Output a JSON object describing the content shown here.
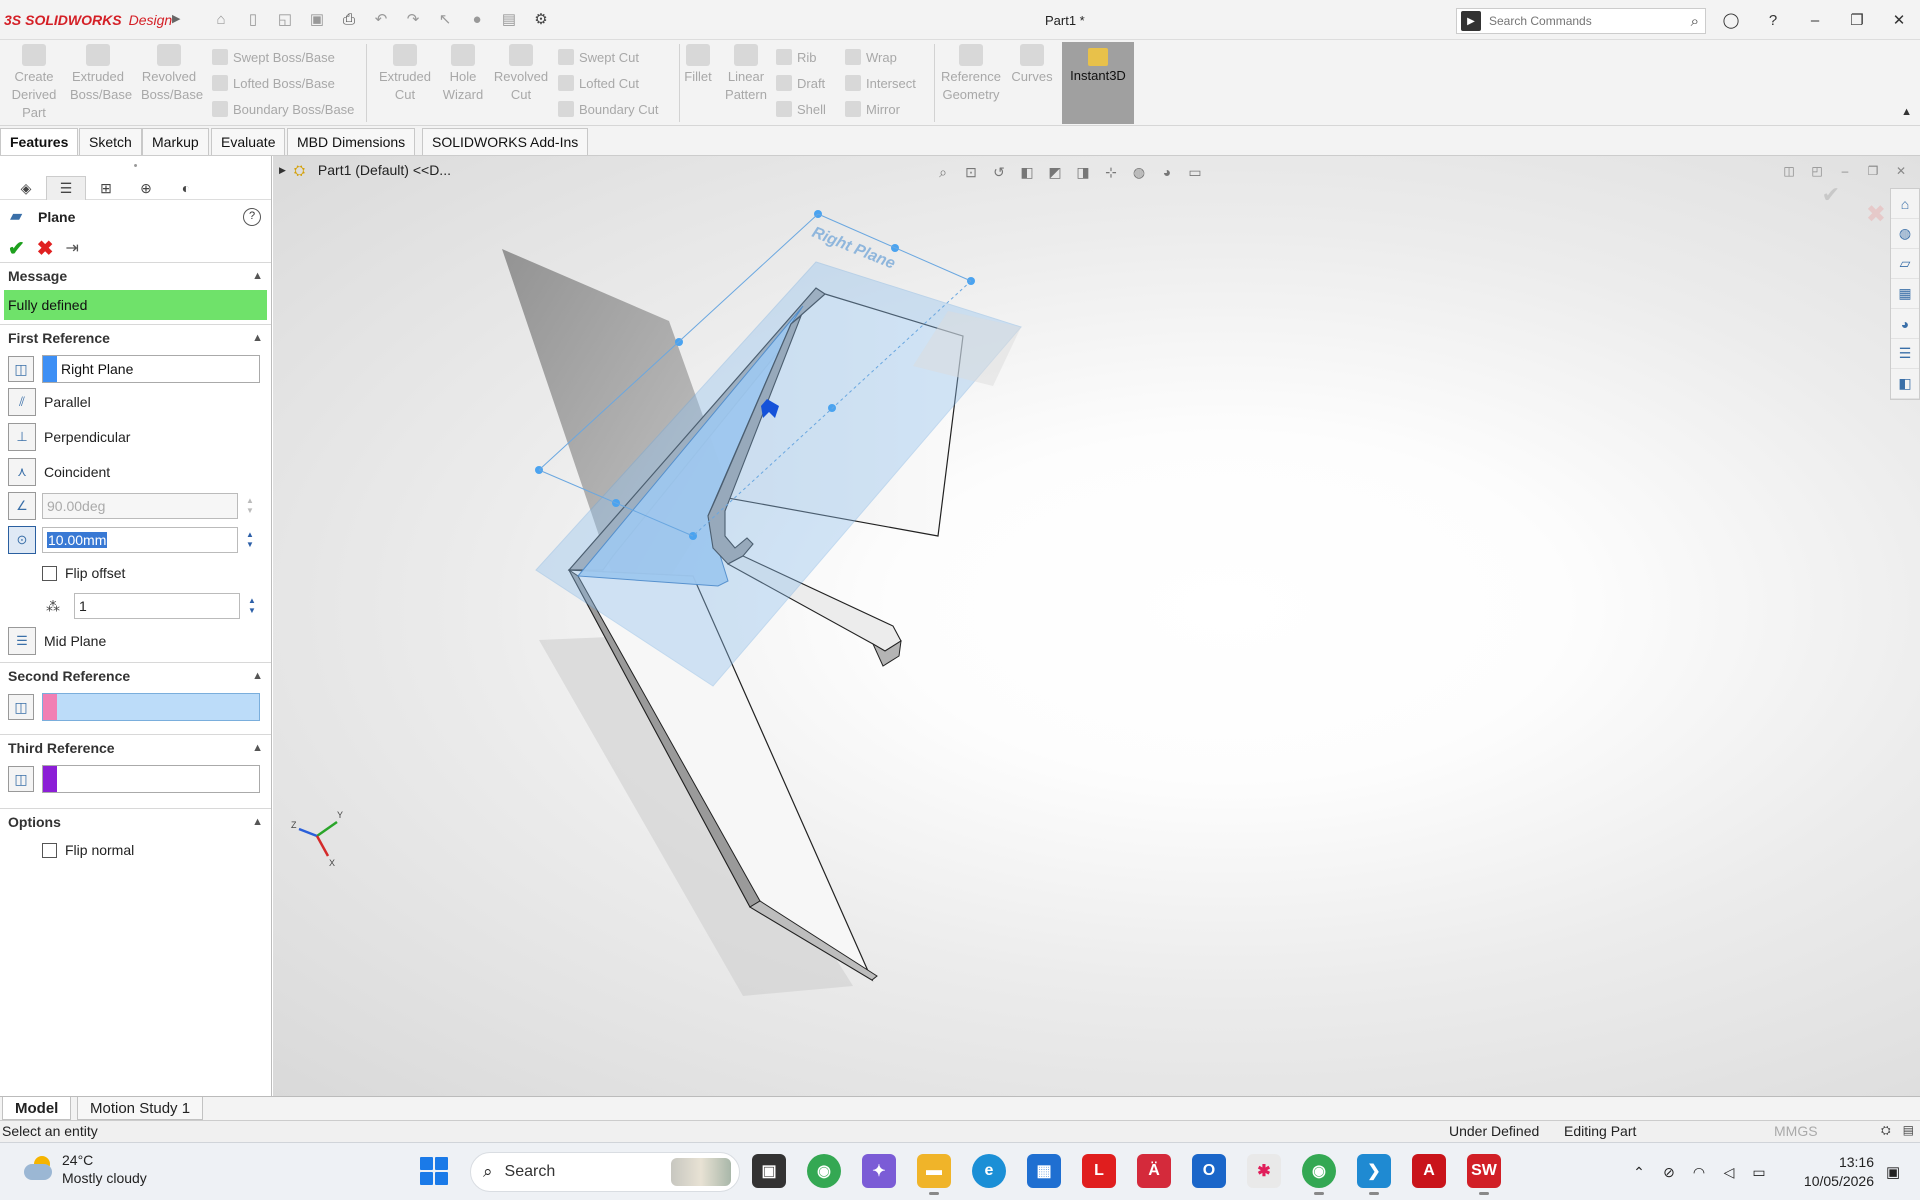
{
  "app": {
    "brand_ds": "3S",
    "brand_name": "SOLIDWORKS",
    "brand_suffix": "Design",
    "doc_title": "Part1 *",
    "search_placeholder": "Search Commands"
  },
  "ribbon": {
    "create_derived": [
      "Create",
      "Derived",
      "Part"
    ],
    "extruded_boss": [
      "Extruded",
      "Boss/Base"
    ],
    "revolved_boss": [
      "Revolved",
      "Boss/Base"
    ],
    "swept_boss": "Swept Boss/Base",
    "lofted_boss": "Lofted Boss/Base",
    "boundary_boss": "Boundary Boss/Base",
    "extruded_cut": [
      "Extruded",
      "Cut"
    ],
    "hole_wizard": [
      "Hole",
      "Wizard"
    ],
    "revolved_cut": [
      "Revolved",
      "Cut"
    ],
    "swept_cut": "Swept Cut",
    "lofted_cut": "Lofted Cut",
    "boundary_cut": "Boundary Cut",
    "fillet": "Fillet",
    "linear_pattern": [
      "Linear",
      "Pattern"
    ],
    "rib": "Rib",
    "draft": "Draft",
    "shell": "Shell",
    "wrap": "Wrap",
    "intersect": "Intersect",
    "mirror": "Mirror",
    "reference_geometry": [
      "Reference",
      "Geometry"
    ],
    "curves": "Curves",
    "instant3d": "Instant3D"
  },
  "tabs": [
    "Features",
    "Sketch",
    "Markup",
    "Evaluate",
    "MBD Dimensions",
    "SOLIDWORKS Add-Ins"
  ],
  "breadcrumb": "Part1 (Default) <<D...",
  "plane_pm": {
    "title": "Plane",
    "message_header": "Message",
    "message": "Fully defined",
    "first_reference_header": "First Reference",
    "first_reference_value": "Right Plane",
    "parallel": "Parallel",
    "perpendicular": "Perpendicular",
    "coincident": "Coincident",
    "angle_value": "90.00deg",
    "offset_value": "10.00mm",
    "flip_offset": "Flip offset",
    "instances": "1",
    "mid_plane": "Mid Plane",
    "second_reference_header": "Second Reference",
    "third_reference_header": "Third Reference",
    "options_header": "Options",
    "flip_normal": "Flip normal",
    "colors": {
      "first": "#3d8ff5",
      "second": "#f17fb4",
      "third": "#8b1ed6",
      "message_bg": "#6fe26a"
    }
  },
  "viewport": {
    "plane_label": "Right Plane",
    "triad": {
      "x": "X",
      "y": "Y",
      "z": "Z"
    }
  },
  "bottom_tabs": [
    "Model",
    "Motion Study 1"
  ],
  "status": {
    "prompt": "Select an entity",
    "definition": "Under Defined",
    "mode": "Editing Part",
    "units": "MMGS"
  },
  "taskbar": {
    "temperature": "24°C",
    "weather": "Mostly cloudy",
    "search": "Search",
    "time": "13:16",
    "date": "10/05/2026"
  }
}
